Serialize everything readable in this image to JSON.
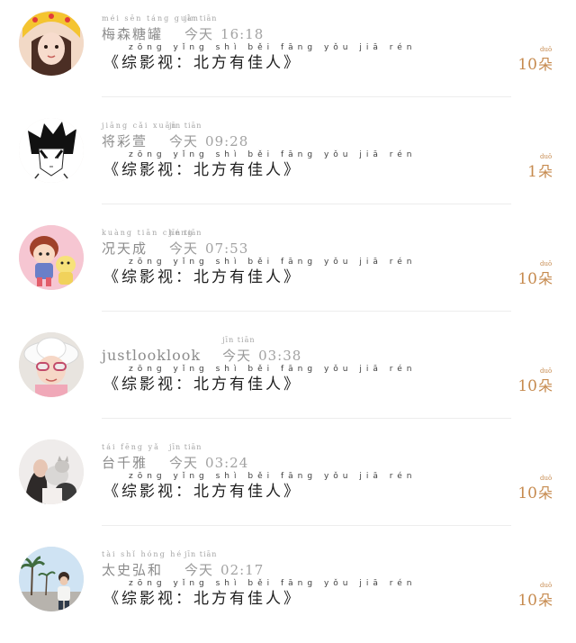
{
  "feed": {
    "items": [
      {
        "avatar": "girl-cat-ear-hood-avatar",
        "name": "梅森糖罐",
        "name_pinyin": "méi sēn táng guàn",
        "time_label": "今天",
        "time_pinyin": "jīn tiān",
        "time": "16:18",
        "message": "《综影视：北方有佳人》",
        "message_pinyin": "zōng yǐng shì běi fāng yǒu jiā rén",
        "count": "10",
        "count_unit": "朵",
        "count_unit_pinyin": "duǒ"
      },
      {
        "avatar": "anime-boy-sketch-avatar",
        "name": "将彩萱",
        "name_pinyin": "jiāng cǎi xuān",
        "time_label": "今天",
        "time_pinyin": "jīn tiān",
        "time": "09:28",
        "message": "《综影视：北方有佳人》",
        "message_pinyin": "zōng yǐng shì běi fāng yǒu jiā rén",
        "count": "1",
        "count_unit": "朵",
        "count_unit_pinyin": "duǒ"
      },
      {
        "avatar": "cartoon-kids-pink-avatar",
        "name": "况天成",
        "name_pinyin": "kuàng tiān chéng",
        "time_label": "今天",
        "time_pinyin": "jīn tiān",
        "time": "07:53",
        "message": "《综影视：北方有佳人》",
        "message_pinyin": "zōng yǐng shì běi fāng yǒu jiā rén",
        "count": "10",
        "count_unit": "朵",
        "count_unit_pinyin": "duǒ"
      },
      {
        "avatar": "child-white-hat-sunglasses-avatar",
        "name": "justlooklook",
        "name_pinyin": "",
        "time_label": "今天",
        "time_pinyin": "jīn tiān",
        "time": "03:38",
        "message": "《综影视：北方有佳人》",
        "message_pinyin": "zōng yǐng shì běi fāng yǒu jiā rén",
        "count": "10",
        "count_unit": "朵",
        "count_unit_pinyin": "duǒ"
      },
      {
        "avatar": "woman-with-cat-avatar",
        "name": "台千雅",
        "name_pinyin": "tái fēng yǎ",
        "time_label": "今天",
        "time_pinyin": "jīn tiān",
        "time": "03:24",
        "message": "《综影视：北方有佳人》",
        "message_pinyin": "zōng yǐng shì běi fāng yǒu jiā rén",
        "count": "10",
        "count_unit": "朵",
        "count_unit_pinyin": "duǒ"
      },
      {
        "avatar": "person-palm-trees-avatar",
        "name": "太史弘和",
        "name_pinyin": "tài shǐ hóng hé",
        "time_label": "今天",
        "time_pinyin": "jīn tiān",
        "time": "02:17",
        "message": "《综影视：北方有佳人》",
        "message_pinyin": "zōng yǐng shì běi fāng yǒu jiā rén",
        "count": "10",
        "count_unit": "朵",
        "count_unit_pinyin": "duǒ"
      }
    ]
  },
  "colors": {
    "accent": "#c68a4e",
    "text": "#1e1e1e",
    "muted": "#8c8c8c",
    "divider": "#ededed"
  }
}
